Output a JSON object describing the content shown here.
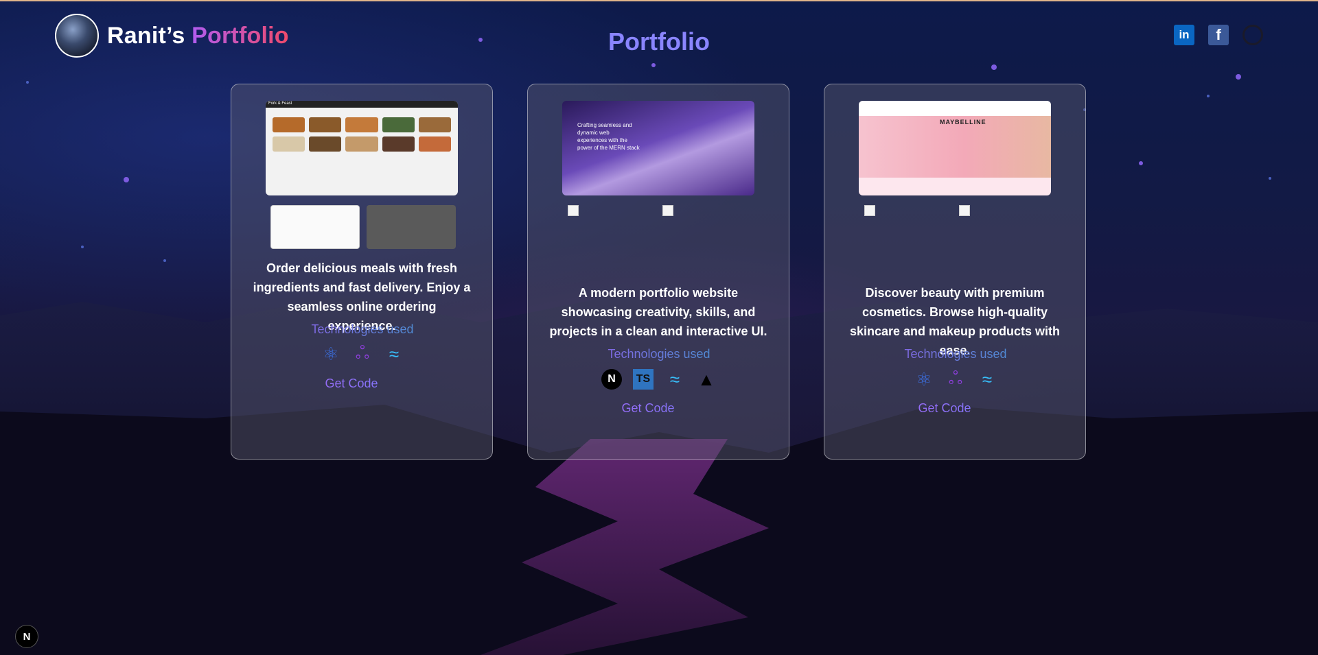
{
  "header": {
    "brand_first": "Ranit’s",
    "brand_accent": "Portfolio",
    "page_title": "Portfolio"
  },
  "socials": [
    {
      "name": "linkedin-icon",
      "glyph": "in"
    },
    {
      "name": "facebook-icon",
      "glyph": "f"
    },
    {
      "name": "github-icon",
      "glyph": ""
    }
  ],
  "projects": [
    {
      "description": "Order delicious meals with fresh ingredients and fast delivery. Enjoy a seamless online ordering experience.",
      "tech_label": "Technologies used",
      "technologies": [
        "react-icon",
        "redux-icon",
        "tailwind-icon"
      ],
      "get_code": "Get Code",
      "preview_title": "Fork & Feast"
    },
    {
      "description": "A modern portfolio website showcasing creativity, skills, and projects in a clean and interactive UI.",
      "tech_label": "Technologies used",
      "technologies": [
        "nextjs-icon",
        "typescript-icon",
        "tailwind-icon",
        "vercel-icon"
      ],
      "get_code": "Get Code",
      "preview_text": "Crafting seamless and dynamic web experiences with the power of the MERN stack"
    },
    {
      "description": "Discover beauty with premium cosmetics. Browse high-quality skincare and makeup products with ease.",
      "tech_label": "Technologies used",
      "technologies": [
        "react-icon",
        "redux-icon",
        "tailwind-icon"
      ],
      "get_code": "Get Code",
      "preview_banner": "MAYBELLINE"
    }
  ],
  "colors": {
    "accent": "#8a85ff",
    "brand_gradient_start": "#b15cf0",
    "brand_gradient_end": "#f04a6a",
    "tech_label_end": "#2aa5c8"
  },
  "footer_badge": "N"
}
